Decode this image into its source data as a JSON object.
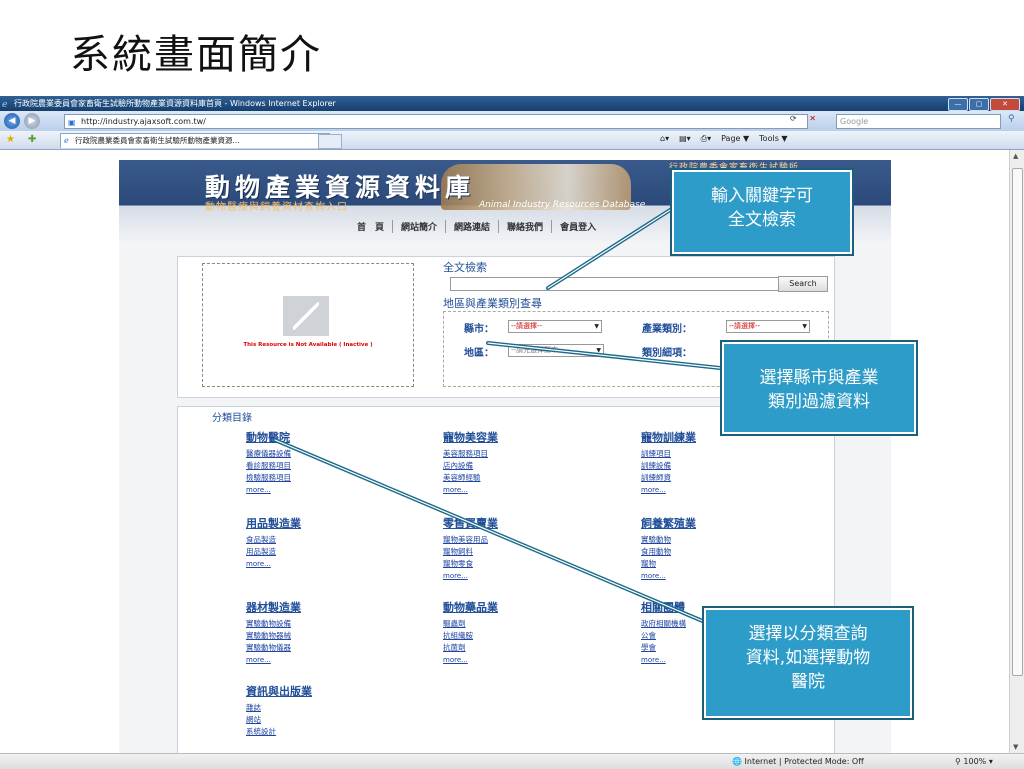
{
  "slide": {
    "title": "系統畫面簡介"
  },
  "window": {
    "title": "行政院農業委員會家畜衛生試驗所動物產業資源資料庫首頁 - Windows Internet Explorer",
    "buttons": {
      "min": "—",
      "max": "▢",
      "close": "✕"
    }
  },
  "address": {
    "url": "http://industry.ajaxsoft.com.tw/",
    "search_placeholder": "Google"
  },
  "tab": {
    "label": "行政院農業委員會家畜衛生試驗所動物產業資源..."
  },
  "commandbar": {
    "page": "Page ▼",
    "tools": "Tools ▼"
  },
  "site": {
    "logo": "動物產業資源資料庫",
    "subtitle": "動物醫療與飼養資材查詢入口",
    "banner_text": "Animal Industry Resources Database",
    "agency": "行政院農委會家畜衛生試驗所",
    "nav": [
      "首　頁",
      "網站簡介",
      "網路連結",
      "聯絡我們",
      "會員登入"
    ]
  },
  "search": {
    "placeholder_msg": "This Resource is Not Available ( Inactive )",
    "fulltext_title": "全文檢索",
    "search_button": "Search",
    "region_title": "地區與產業類別查尋",
    "county_label": "縣市：",
    "county_value": "--請選擇--",
    "industry_label": "產業類別：",
    "industry_value": "--請選擇--",
    "area_label": "地區：",
    "area_value": "--請先選擇縣市--",
    "detail_label": "類別細項："
  },
  "categories": {
    "title": "分類目錄",
    "columns": [
      {
        "head": "動物醫院",
        "links": [
          "醫療儀器設備",
          "看診服務項目",
          "檢驗服務項目"
        ],
        "more": "more..."
      },
      {
        "head": "寵物美容業",
        "links": [
          "美容服務項目",
          "店內設備",
          "美容師經驗"
        ],
        "more": "more..."
      },
      {
        "head": "寵物訓練業",
        "links": [
          "訓練項目",
          "訓練設備",
          "訓練師資"
        ],
        "more": "more..."
      },
      {
        "head": "用品製造業",
        "links": [
          "食品製造",
          "用品製造"
        ],
        "more": "more..."
      },
      {
        "head": "零售買賣業",
        "links": [
          "寵物美容用品",
          "寵物飼料",
          "寵物零食"
        ],
        "more": "more..."
      },
      {
        "head": "飼養繁殖業",
        "links": [
          "實驗動物",
          "食用動物",
          "寵物"
        ],
        "more": "more..."
      },
      {
        "head": "器材製造業",
        "links": [
          "實驗動物設備",
          "實驗動物器械",
          "實驗動物儀器"
        ],
        "more": "more..."
      },
      {
        "head": "動物藥品業",
        "links": [
          "驅蟲劑",
          "抗組織胺",
          "抗菌劑"
        ],
        "more": "more..."
      },
      {
        "head": "相關團體",
        "links": [
          "政府相關機構",
          "公會",
          "學會"
        ],
        "more": "more..."
      },
      {
        "head": "資訊與出版業",
        "links": [
          "雜誌",
          "網站",
          "系統設計"
        ],
        "more": ""
      }
    ]
  },
  "status": {
    "zone": "Internet | Protected Mode: Off",
    "zoom": "100%"
  },
  "callouts": {
    "fulltext": "輸入關鍵字可\n全文檢索",
    "filter": "選擇縣市與產業\n類別過濾資料",
    "category": "選擇以分類查詢\n資料,如選擇動物\n醫院"
  },
  "colors": {
    "callout_bg": "#2e9cc8",
    "callout_border": "#1c5f7d",
    "arrow": "#1c6a8a",
    "link": "#224f99"
  }
}
